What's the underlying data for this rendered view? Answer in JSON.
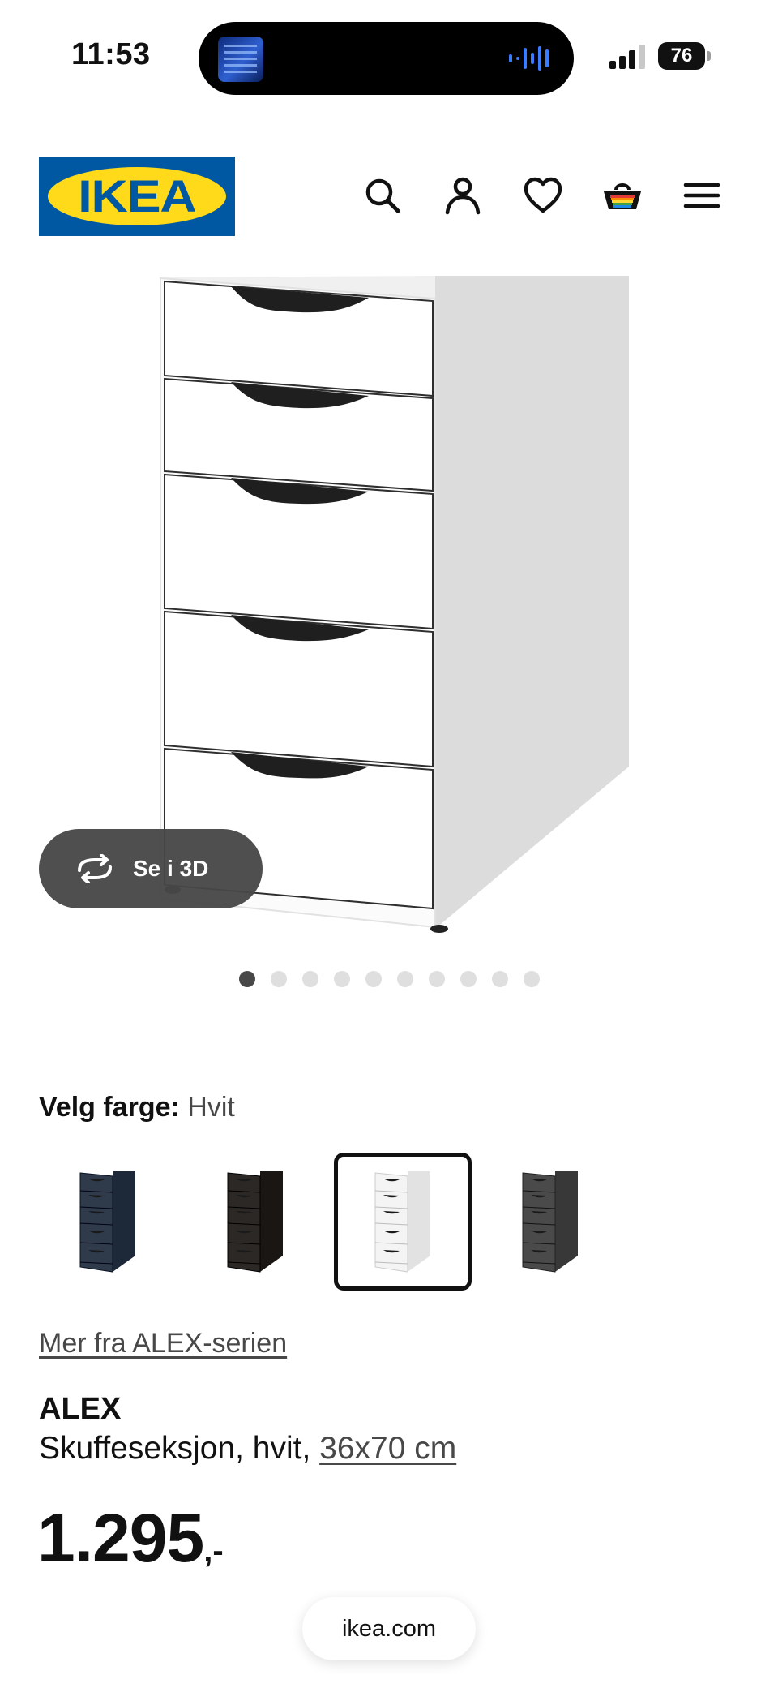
{
  "status_bar": {
    "time": "11:53",
    "battery": "76"
  },
  "header": {
    "logo_text": "IKEA",
    "icons": [
      "search-icon",
      "user-icon",
      "heart-icon",
      "cart-icon",
      "menu-icon"
    ]
  },
  "gallery": {
    "view_3d_label": "Se i 3D",
    "dot_count": 10,
    "active_dot": 0
  },
  "variant": {
    "label": "Velg farge:",
    "value": "Hvit",
    "swatches": [
      {
        "name": "blue",
        "color": "#2f3a4a"
      },
      {
        "name": "black-brown",
        "color": "#2b2825"
      },
      {
        "name": "white",
        "color": "#f4f4f4",
        "selected": true
      },
      {
        "name": "grey",
        "color": "#4a4a4a"
      }
    ]
  },
  "series_link": "Mer fra ALEX-serien",
  "product": {
    "name": "ALEX",
    "description": "Skuffeseksjon, hvit, ",
    "size": "36x70 cm"
  },
  "price": {
    "integer": "1.295",
    "decimal": ",-"
  },
  "browser": {
    "url": "ikea.com"
  },
  "colors": {
    "brand_blue": "#0058a3",
    "brand_yellow": "#ffda1a",
    "text": "#111111",
    "muted": "#484848"
  }
}
